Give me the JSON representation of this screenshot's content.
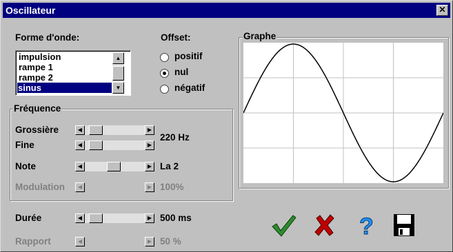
{
  "window": {
    "title": "Oscillateur",
    "close_label": "✕"
  },
  "waveform": {
    "label": "Forme d'onde:",
    "items": [
      "impulsion",
      "rampe 1",
      "rampe 2",
      "sinus"
    ],
    "selected": "sinus"
  },
  "offset": {
    "label": "Offset:",
    "options": [
      "positif",
      "nul",
      "négatif"
    ],
    "selected": "nul"
  },
  "frequency": {
    "group_label": "Fréquence",
    "coarse_label": "Grossière",
    "fine_label": "Fine",
    "value": "220 Hz",
    "note_label": "Note",
    "note_value": "La 2",
    "modulation_label": "Modulation",
    "modulation_value": "100%"
  },
  "duration": {
    "label": "Durée",
    "value": "500 ms"
  },
  "ratio": {
    "label": "Rapport",
    "value": "50 %"
  },
  "graph": {
    "label": "Graphe"
  },
  "toolbar": {
    "ok_icon": "checkmark-icon",
    "cancel_icon": "cross-icon",
    "help_icon": "question-icon",
    "save_icon": "floppy-disk-icon"
  },
  "colors": {
    "title_bg": "#000080",
    "check": "#2e8b2e",
    "cross": "#c00000",
    "help": "#1e90ff"
  },
  "sliders": {
    "coarse": 0.17,
    "fine": 0.17,
    "note": 0.42,
    "modulation": 0.0,
    "duration": 0.17,
    "ratio": 0.0
  }
}
